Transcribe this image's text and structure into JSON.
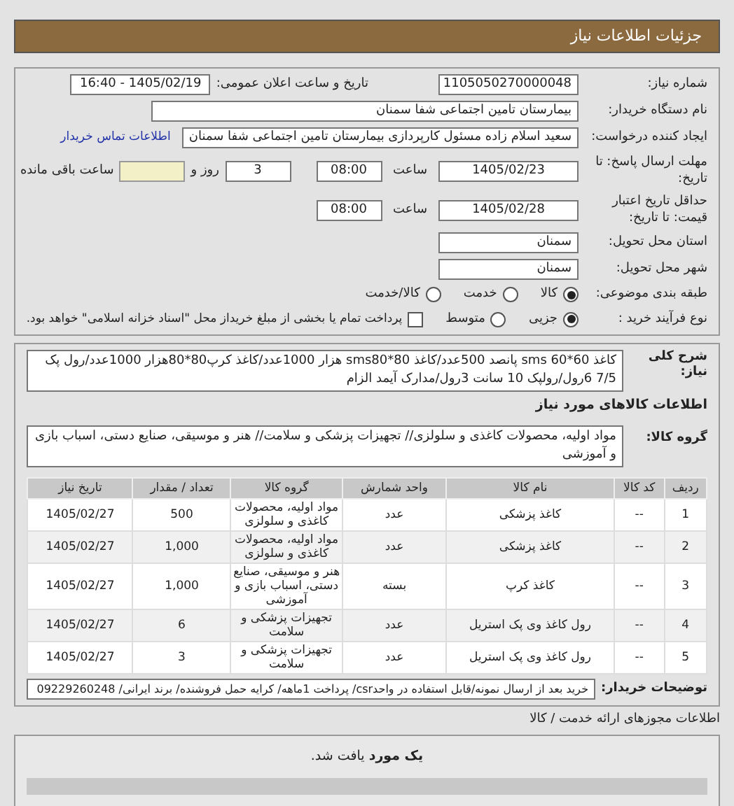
{
  "header": {
    "title": "جزئیات اطلاعات نیاز"
  },
  "fields": {
    "need_number": {
      "label": "شماره نیاز:",
      "value": "1105050270000048"
    },
    "announce": {
      "label": "تاریخ و ساعت اعلان عمومی:",
      "value": "1405/02/19 - 16:40"
    },
    "buyer": {
      "label": "نام دستگاه خریدار:",
      "value": "بیمارستان تامین اجتماعی شفا سمنان"
    },
    "creator": {
      "label": "ایجاد کننده درخواست:",
      "value": "سعید اسلام زاده مسئول کارپردازی بیمارستان تامین اجتماعی شفا سمنان",
      "link": "اطلاعات تماس خریدار"
    },
    "deadline": {
      "label": "مهلت ارسال پاسخ: تا تاریخ:",
      "date": "1405/02/23",
      "time_label": "ساعت",
      "time": "08:00",
      "days": "3",
      "days_label": "روز و",
      "remaining_label": "ساعت باقی مانده"
    },
    "validity": {
      "label": "حداقل تاریخ اعتبار قیمت: تا تاریخ:",
      "date": "1405/02/28",
      "time_label": "ساعت",
      "time": "08:00"
    },
    "province": {
      "label": "استان محل تحویل:",
      "value": "سمنان"
    },
    "city": {
      "label": "شهر محل تحویل:",
      "value": "سمنان"
    }
  },
  "category": {
    "label": "طبقه بندی موضوعی:",
    "options": [
      {
        "label": "کالا",
        "selected": true
      },
      {
        "label": "خدمت",
        "selected": false
      },
      {
        "label": "کالا/خدمت",
        "selected": false
      }
    ]
  },
  "process": {
    "label": "نوع فرآیند خرید :",
    "options": [
      {
        "label": "جزیی",
        "selected": true
      },
      {
        "label": "متوسط",
        "selected": false
      }
    ],
    "payment": {
      "label": "پرداخت تمام یا بخشی از مبلغ خریداز محل \"اسناد خزانه اسلامی\" خواهد بود.",
      "checked": false
    }
  },
  "description": {
    "label": "شرح کلی نیاز:",
    "value": "کاغذ 60*60 sms پانصد 500عدد/کاغذ 80*sms80 هزار 1000عدد/کاغذ کرپ80*80هزار 1000عدد/رول پک 7/5 6رول/رولپک 10 سانت 3رول/مدارک آیمد الزام"
  },
  "goods_title": "اطلاعات کالاهای مورد نیاز",
  "goods_group": {
    "label": "گروه کالا:",
    "value": "مواد اولیه، محصولات کاغذی و سلولزی// تجهیزات پزشکی و سلامت// هنر و موسیقی، صنایع دستی، اسباب بازی و آموزشی"
  },
  "table": {
    "columns": [
      "ردیف",
      "کد کالا",
      "نام کالا",
      "واحد شمارش",
      "گروه کالا",
      "تعداد / مقدار",
      "تاریخ نیاز"
    ],
    "rows": [
      [
        "1",
        "--",
        "کاغذ پزشکی",
        "عدد",
        "مواد اولیه، محصولات کاغذی و سلولزی",
        "500",
        "1405/02/27"
      ],
      [
        "2",
        "--",
        "کاغذ پزشکی",
        "عدد",
        "مواد اولیه، محصولات کاغذی و سلولزی",
        "1,000",
        "1405/02/27"
      ],
      [
        "3",
        "--",
        "کاغذ کرپ",
        "بسته",
        "هنر و موسیقی، صنایع دستی، اسباب بازی و آموزشی",
        "1,000",
        "1405/02/27"
      ],
      [
        "4",
        "--",
        "رول کاغذ وی پک استریل",
        "عدد",
        "تجهیزات پزشکی و سلامت",
        "6",
        "1405/02/27"
      ],
      [
        "5",
        "--",
        "رول کاغذ وی پک استریل",
        "عدد",
        "تجهیزات پزشکی و سلامت",
        "3",
        "1405/02/27"
      ]
    ]
  },
  "buyer_notes": {
    "label": "توضیحات خریدار:",
    "value": "خرید بعد از ارسال نمونه/قابل استفاده در واحدcsr/ پرداخت 1ماهه/ کرایه حمل فروشنده/ برند ایرانی/ 09229260248"
  },
  "licenses": {
    "title": "اطلاعات مجوزهای ارائه خدمت / کالا",
    "result": "**یک مورد** یافت شد."
  }
}
